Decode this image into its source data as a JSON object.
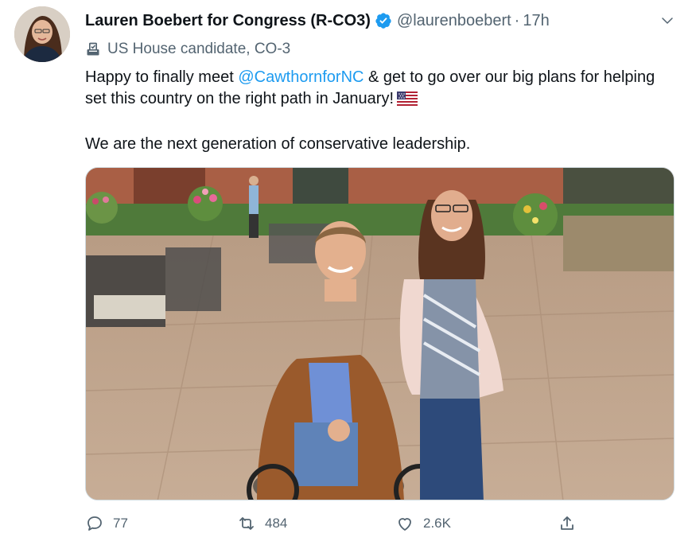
{
  "tweet": {
    "author_name": "Lauren Boebert for Congress (R-CO3)",
    "handle": "@laurenboebert",
    "separator": "·",
    "time": "17h",
    "label": "US House candidate, CO-3",
    "text": {
      "line1_prefix": "Happy to finally meet ",
      "mention": "@CawthornforNC",
      "line1_suffix": " & get to go over our big plans for helping set this country on the right path in January!",
      "paragraph2": "We are the next generation of conservative leadership."
    },
    "stats": {
      "replies": "77",
      "retweets": "484",
      "likes": "2.6K"
    }
  },
  "icons": {
    "verified": "verified-badge-icon",
    "caret": "chevron-down-icon",
    "label": "ballot-box-icon",
    "flag": "us-flag-icon",
    "reply": "reply-icon",
    "retweet": "retweet-icon",
    "like": "heart-icon",
    "share": "share-icon"
  },
  "colors": {
    "accent": "#1d9bf0",
    "secondary_text": "#536471",
    "primary_text": "#0f1419"
  }
}
